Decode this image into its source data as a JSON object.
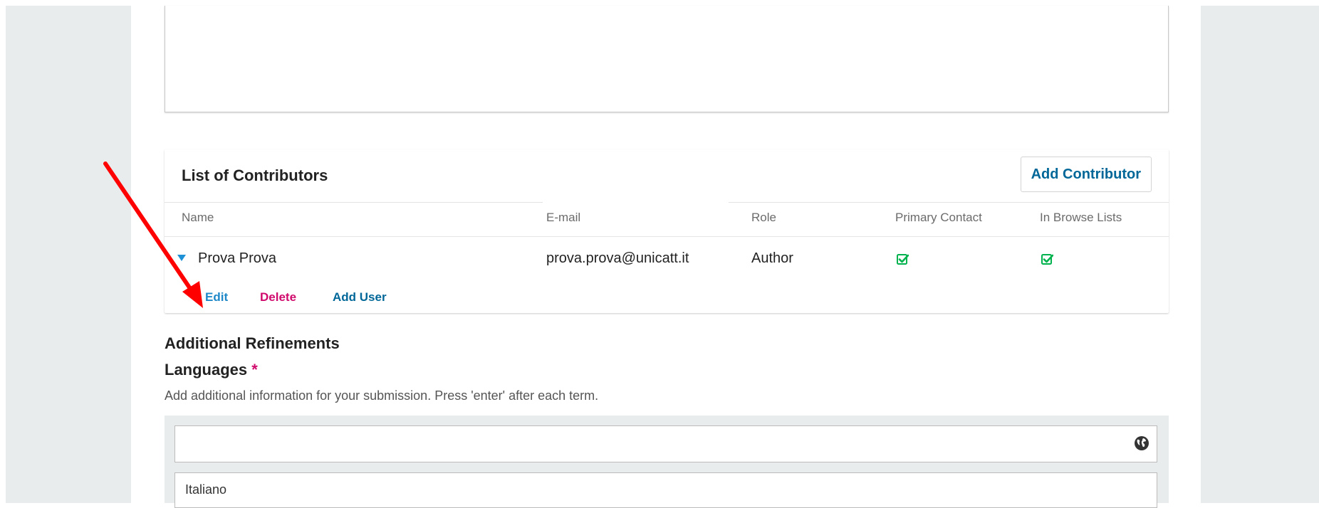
{
  "contributors": {
    "title": "List of Contributors",
    "add_button": "Add Contributor",
    "columns": {
      "name": "Name",
      "email": "E-mail",
      "role": "Role",
      "primary_contact": "Primary Contact",
      "browse": "In Browse Lists"
    },
    "rows": [
      {
        "name": "Prova Prova",
        "email": "prova.prova@unicatt.it",
        "role": "Author",
        "primary_contact": true,
        "in_browse_lists": true
      }
    ],
    "actions": {
      "edit": "Edit",
      "delete": "Delete",
      "add_user": "Add User"
    }
  },
  "refinements": {
    "section_title": "Additional Refinements",
    "languages_label": "Languages",
    "required_mark": "*",
    "description": "Add additional information for your submission. Press 'enter' after each term.",
    "tags": [
      "Italiano"
    ]
  },
  "colors": {
    "link_blue": "#1e88c8",
    "delete_pink": "#d00a6c",
    "add_user_blue": "#006798",
    "check_green": "#00b24e",
    "annotation_arrow": "#ff0000",
    "sidebar_gray": "#e9ecec"
  },
  "icons": {
    "expand": "caret-down-icon",
    "check": "checkbox-checked-icon",
    "globe": "globe-icon",
    "annotation": "red-arrow"
  }
}
